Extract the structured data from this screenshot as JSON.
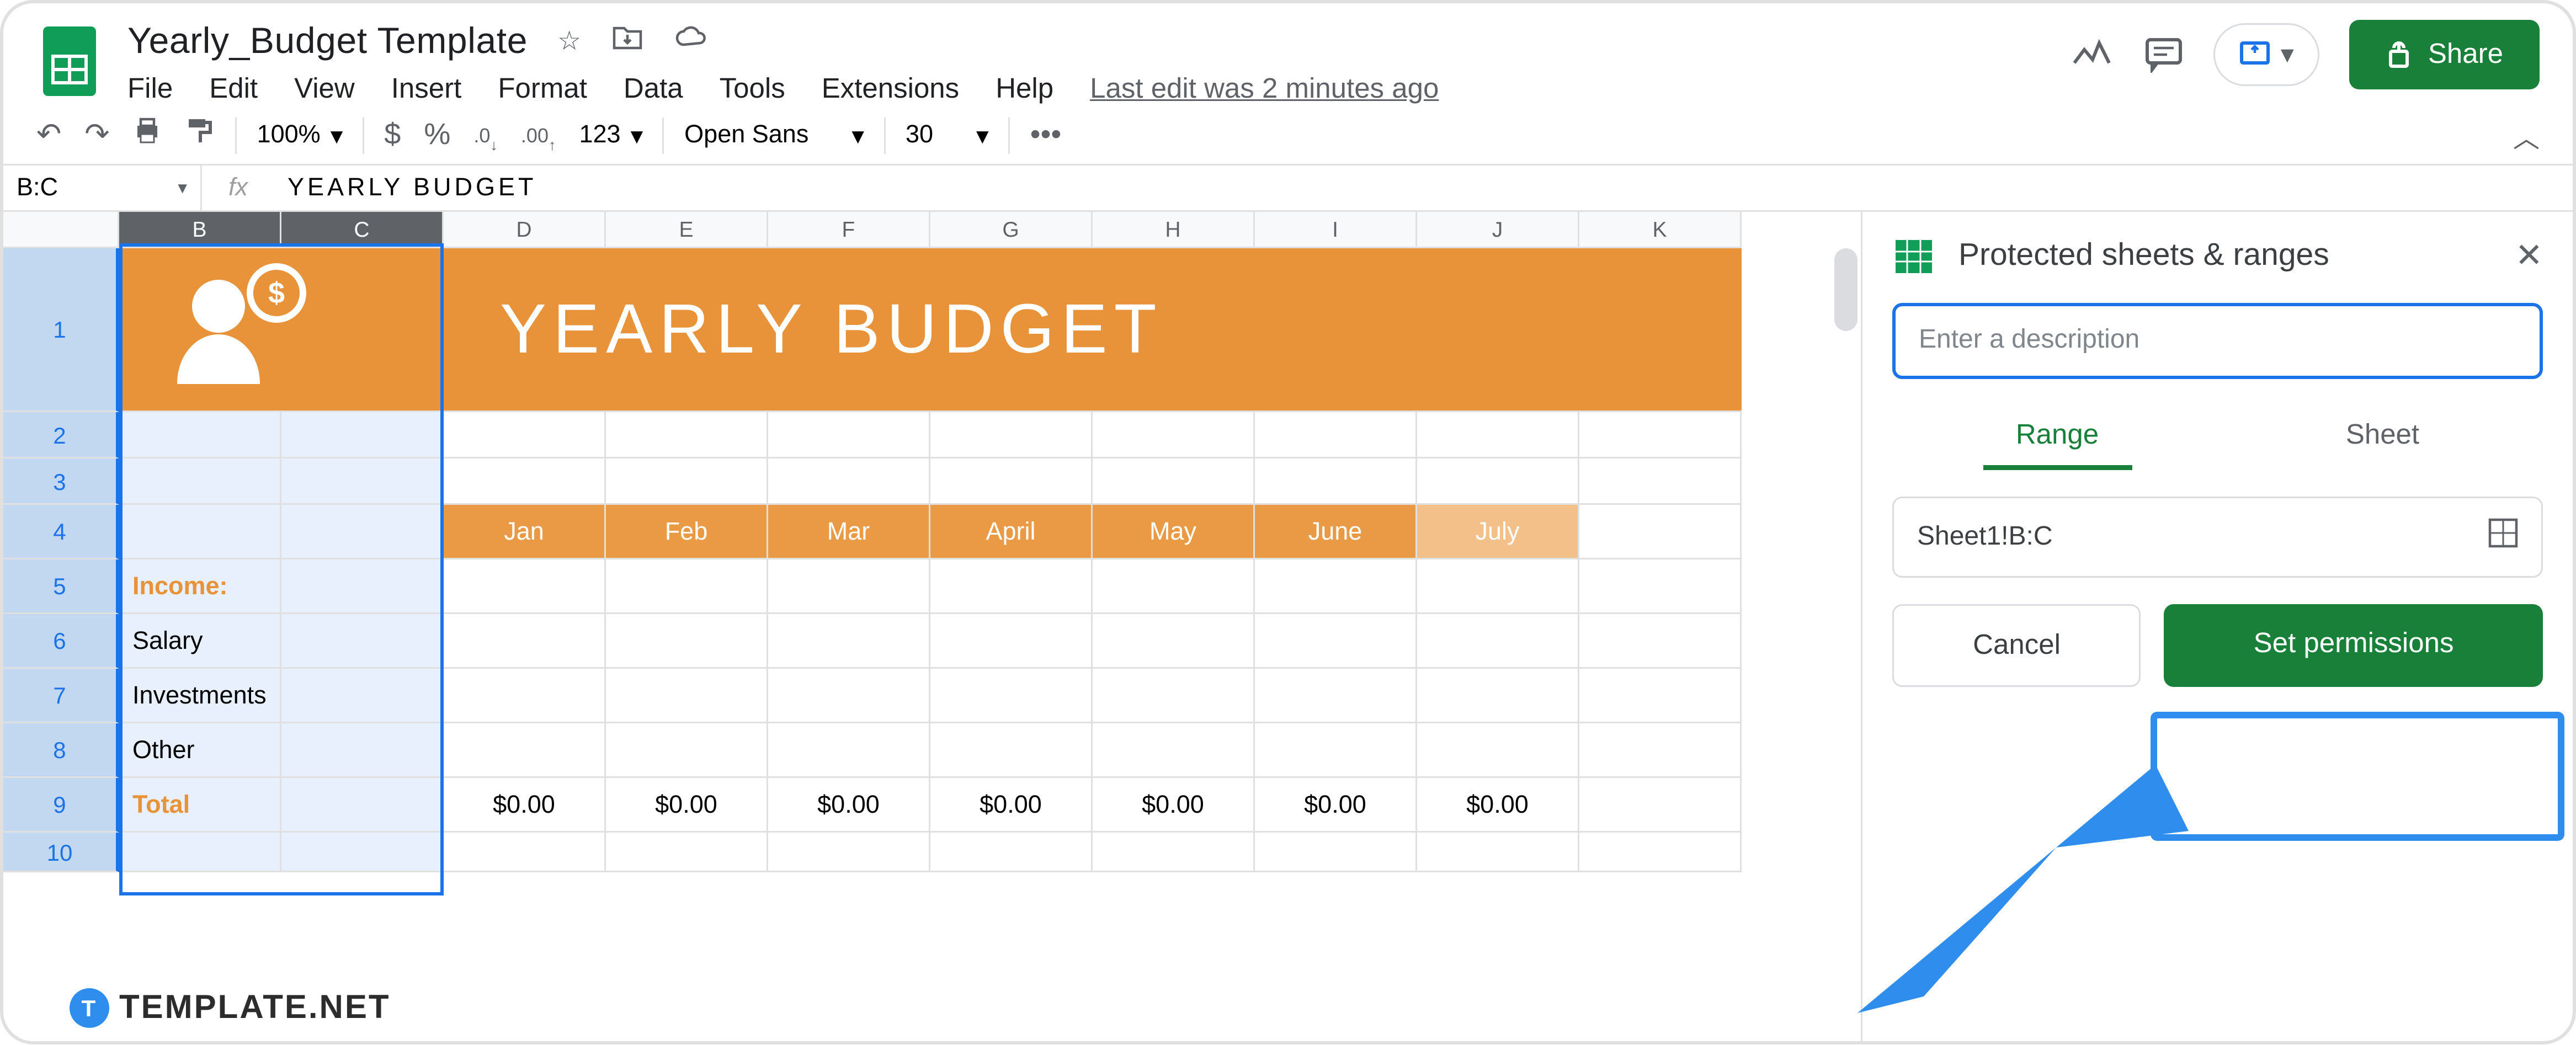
{
  "doc_title": "Yearly_Budget Template",
  "menu": {
    "file": "File",
    "edit": "Edit",
    "view": "View",
    "insert": "Insert",
    "format": "Format",
    "data": "Data",
    "tools": "Tools",
    "extensions": "Extensions",
    "help": "Help"
  },
  "last_edit": "Last edit was 2 minutes ago",
  "share_label": "Share",
  "toolbar": {
    "zoom": "100%",
    "currency": "$",
    "percent": "%",
    "dec_dec": ".0",
    "inc_dec": ".00",
    "num_fmt": "123",
    "font": "Open Sans",
    "font_size": "30"
  },
  "name_box": "B:C",
  "formula_value": "YEARLY BUDGET",
  "columns": [
    "",
    "B",
    "C",
    "D",
    "E",
    "F",
    "G",
    "H",
    "I",
    "J",
    "K"
  ],
  "banner_title": "YEARLY BUDGET",
  "months": [
    "Jan",
    "Feb",
    "Mar",
    "April",
    "May",
    "June",
    "July"
  ],
  "row_labels": {
    "income": "Income:",
    "salary": "Salary",
    "investments": "Investments",
    "other": "Other",
    "total": "Total"
  },
  "totals": [
    "$0.00",
    "$0.00",
    "$0.00",
    "$0.00",
    "$0.00",
    "$0.00",
    "$0.00"
  ],
  "rows": [
    "1",
    "2",
    "3",
    "4",
    "5",
    "6",
    "7",
    "8",
    "9",
    "10"
  ],
  "panel": {
    "title": "Protected sheets & ranges",
    "desc_placeholder": "Enter a description",
    "tab_range": "Range",
    "tab_sheet": "Sheet",
    "range_value": "Sheet1!B:C",
    "cancel": "Cancel",
    "set_permissions": "Set permissions"
  },
  "watermark": "TEMPLATE.NET"
}
